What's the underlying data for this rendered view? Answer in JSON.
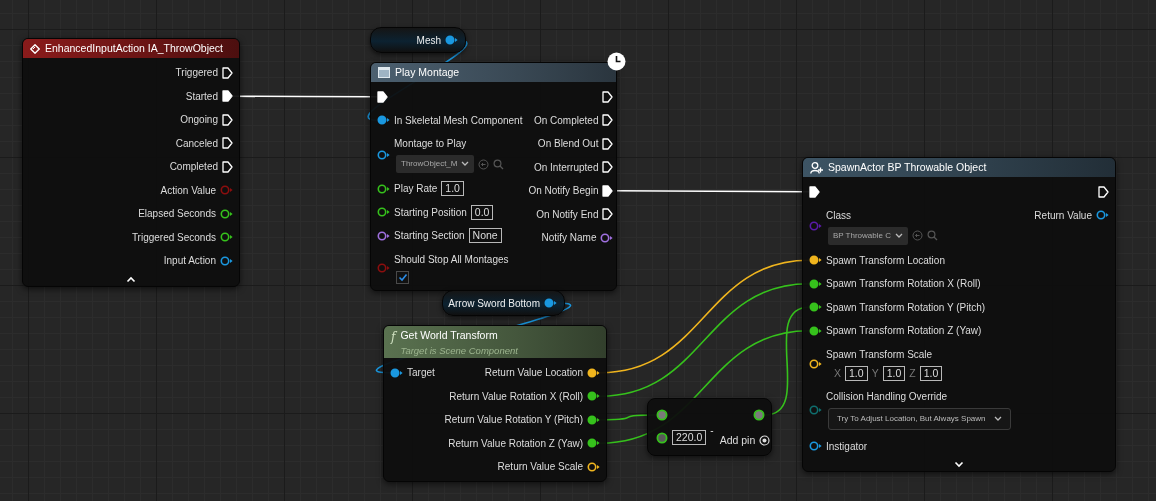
{
  "nodes": [
    {
      "kind": "event",
      "title": "EnhancedInputAction IA_ThrowObject",
      "color": "#8a1b1b",
      "advanced_expanded": true,
      "outputs": [
        {
          "label": "Triggered",
          "kind": "exec",
          "connected": false
        },
        {
          "label": "Started",
          "kind": "exec",
          "connected": true
        },
        {
          "label": "Ongoing",
          "kind": "exec",
          "connected": false
        },
        {
          "label": "Canceled",
          "kind": "exec",
          "connected": false
        },
        {
          "label": "Completed",
          "kind": "exec",
          "connected": false
        },
        {
          "label": "Action Value",
          "kind": "data",
          "color": "#8c0e0e",
          "connected": false
        },
        {
          "label": "Elapsed Seconds",
          "kind": "data",
          "color": "#36c21c",
          "connected": false
        },
        {
          "label": "Triggered Seconds",
          "kind": "data",
          "color": "#36c21c",
          "connected": false
        },
        {
          "label": "Input Action",
          "kind": "data",
          "color": "#1a98e0",
          "connected": false
        }
      ]
    },
    {
      "kind": "variable",
      "label": "Mesh",
      "pin": {
        "color": "#1a98e0",
        "connected": true
      }
    },
    {
      "kind": "latent",
      "title": "Play Montage",
      "color": "#4c6070",
      "inputs": [
        {
          "kind": "exec",
          "connected": true
        },
        {
          "label": "In Skeletal Mesh Component",
          "kind": "data",
          "color": "#1a98e0",
          "connected": true
        },
        {
          "label": "Montage to Play",
          "kind": "data",
          "color": "#1a98e0",
          "connected": false,
          "widget": {
            "kind": "asset",
            "value": "ThrowObject_M"
          }
        },
        {
          "label": "Play Rate",
          "kind": "data",
          "color": "#36c21c",
          "connected": false,
          "widget": {
            "kind": "number",
            "value": "1.0"
          }
        },
        {
          "label": "Starting Position",
          "kind": "data",
          "color": "#36c21c",
          "connected": false,
          "widget": {
            "kind": "number",
            "value": "0.0"
          }
        },
        {
          "label": "Starting Section",
          "kind": "data",
          "color": "#a070e0",
          "connected": false,
          "widget": {
            "kind": "number",
            "value": "None"
          }
        },
        {
          "label": "Should Stop All Montages",
          "kind": "data",
          "color": "#8c0e0e",
          "connected": false,
          "widget": {
            "kind": "checkbox",
            "checked": true
          }
        }
      ],
      "outputs": [
        {
          "kind": "exec",
          "connected": false
        },
        {
          "label": "On Completed",
          "kind": "exec",
          "connected": false
        },
        {
          "label": "On Blend Out",
          "kind": "exec",
          "connected": false
        },
        {
          "label": "On Interrupted",
          "kind": "exec",
          "connected": false
        },
        {
          "label": "On Notify Begin",
          "kind": "exec",
          "connected": true
        },
        {
          "label": "On Notify End",
          "kind": "exec",
          "connected": false
        },
        {
          "label": "Notify Name",
          "kind": "data",
          "color": "#a070e0",
          "connected": false
        }
      ]
    },
    {
      "kind": "variable",
      "label": "Arrow Sword Bottom",
      "pin": {
        "color": "#1a98e0",
        "connected": true
      }
    },
    {
      "kind": "pure",
      "icon_text": "f",
      "title": "Get World Transform",
      "subtitle": "Target is Scene Component",
      "color": "#5a7250",
      "inputs": [
        {
          "label": "Target",
          "kind": "data",
          "color": "#1a98e0",
          "connected": true
        }
      ],
      "outputs": [
        {
          "label": "Return Value Location",
          "kind": "data",
          "color": "#f0b51e",
          "connected": true
        },
        {
          "label": "Return Value Rotation X (Roll)",
          "kind": "data",
          "color": "#36c21c",
          "connected": true
        },
        {
          "label": "Return Value Rotation Y (Pitch)",
          "kind": "data",
          "color": "#36c21c",
          "connected": true
        },
        {
          "label": "Return Value Rotation Z (Yaw)",
          "kind": "data",
          "color": "#36c21c",
          "connected": true
        },
        {
          "label": "Return Value Scale",
          "kind": "data",
          "color": "#f0b51e",
          "connected": false
        }
      ]
    },
    {
      "kind": "math",
      "operator": "-",
      "add_pin": "Add pin",
      "inputs": [
        {
          "kind": "data",
          "color": "#36c21c",
          "connected": true
        },
        {
          "kind": "data",
          "color": "#36c21c",
          "connected": false,
          "widget": {
            "kind": "number",
            "value": "220.0"
          }
        }
      ],
      "outputs": [
        {
          "kind": "data",
          "color": "#36c21c",
          "connected": true
        }
      ]
    },
    {
      "kind": "spawn",
      "title": "SpawnActor BP Throwable Object",
      "color": "#3d5464",
      "advanced_expanded": false,
      "inputs": [
        {
          "kind": "exec",
          "connected": true
        },
        {
          "label": "Class",
          "kind": "data",
          "color": "#5a1aa8",
          "connected": false,
          "widget": {
            "kind": "asset",
            "value": "BP Throwable C"
          }
        },
        {
          "label": "Spawn Transform Location",
          "kind": "data",
          "color": "#f0b51e",
          "connected": true
        },
        {
          "label": "Spawn Transform Rotation X (Roll)",
          "kind": "data",
          "color": "#36c21c",
          "connected": true
        },
        {
          "label": "Spawn Transform Rotation Y (Pitch)",
          "kind": "data",
          "color": "#36c21c",
          "connected": true
        },
        {
          "label": "Spawn Transform Rotation Z (Yaw)",
          "kind": "data",
          "color": "#36c21c",
          "connected": true
        },
        {
          "label": "Spawn Transform Scale",
          "kind": "data",
          "color": "#f0b51e",
          "connected": false,
          "widget": {
            "kind": "vector",
            "items": [
              {
                "axis": "X",
                "value": "1.0"
              },
              {
                "axis": "Y",
                "value": "1.0"
              },
              {
                "axis": "Z",
                "value": "1.0"
              }
            ]
          }
        },
        {
          "label": "Collision Handling Override",
          "kind": "data",
          "color": "#0f6e6e",
          "connected": false,
          "widget": {
            "kind": "enum",
            "value": "Try To Adjust Location, But Always Spawn"
          }
        },
        {
          "label": "Instigator",
          "kind": "data",
          "color": "#1a98e0",
          "connected": false
        }
      ],
      "outputs": [
        {
          "kind": "exec",
          "connected": false
        },
        {
          "label": "Return Value",
          "kind": "data",
          "color": "#1a98e0",
          "connected": false
        }
      ]
    }
  ]
}
